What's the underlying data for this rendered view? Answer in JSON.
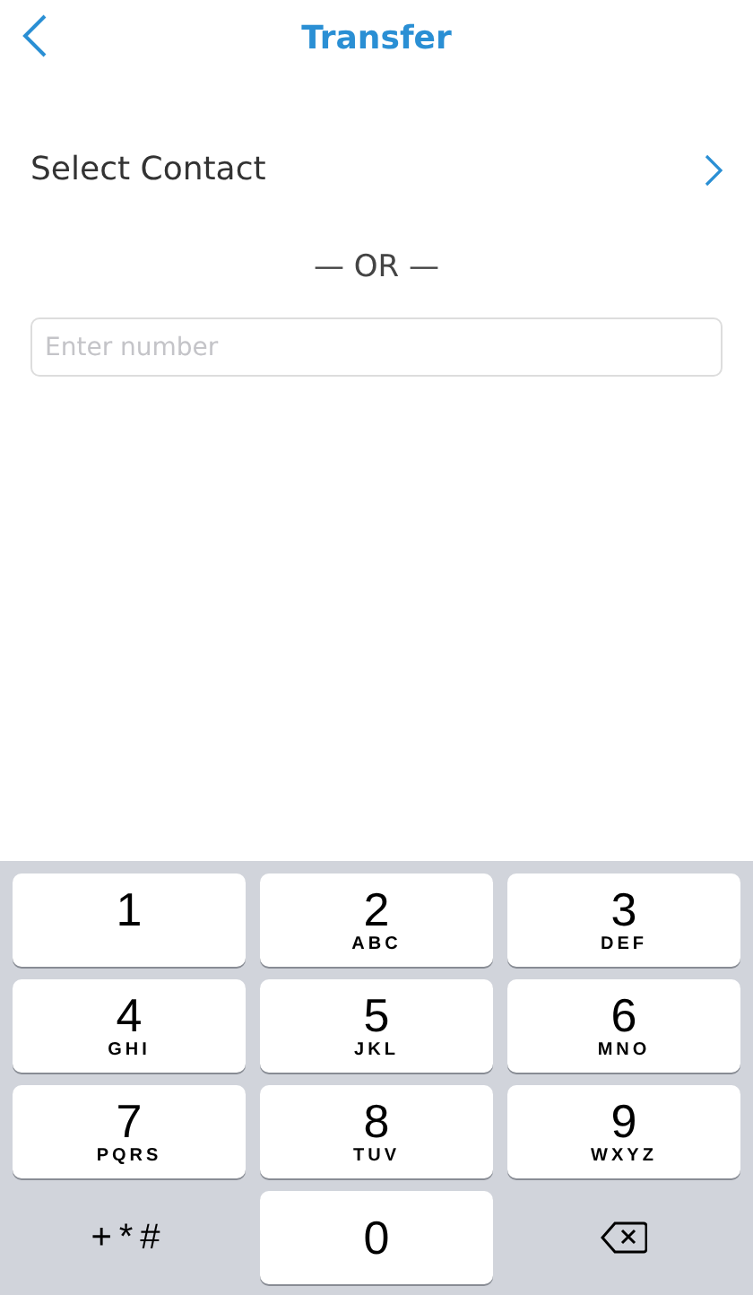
{
  "header": {
    "title": "Transfer"
  },
  "contact": {
    "label": "Select Contact"
  },
  "divider": "— OR —",
  "number_field": {
    "placeholder": "Enter number"
  },
  "keypad": [
    {
      "kind": "digit",
      "digit": "1"
    },
    {
      "kind": "digit",
      "digit": "2",
      "letters": "ABC"
    },
    {
      "kind": "digit",
      "digit": "3",
      "letters": "DEF"
    },
    {
      "kind": "digit",
      "digit": "4",
      "letters": "GHI"
    },
    {
      "kind": "digit",
      "digit": "5",
      "letters": "JKL"
    },
    {
      "kind": "digit",
      "digit": "6",
      "letters": "MNO"
    },
    {
      "kind": "digit",
      "digit": "7",
      "letters": "PQRS"
    },
    {
      "kind": "digit",
      "digit": "8",
      "letters": "TUV"
    },
    {
      "kind": "digit",
      "digit": "9",
      "letters": "WXYZ"
    },
    {
      "kind": "symbols",
      "label": "+*#"
    },
    {
      "kind": "digit",
      "digit": "0"
    },
    {
      "kind": "delete"
    }
  ]
}
